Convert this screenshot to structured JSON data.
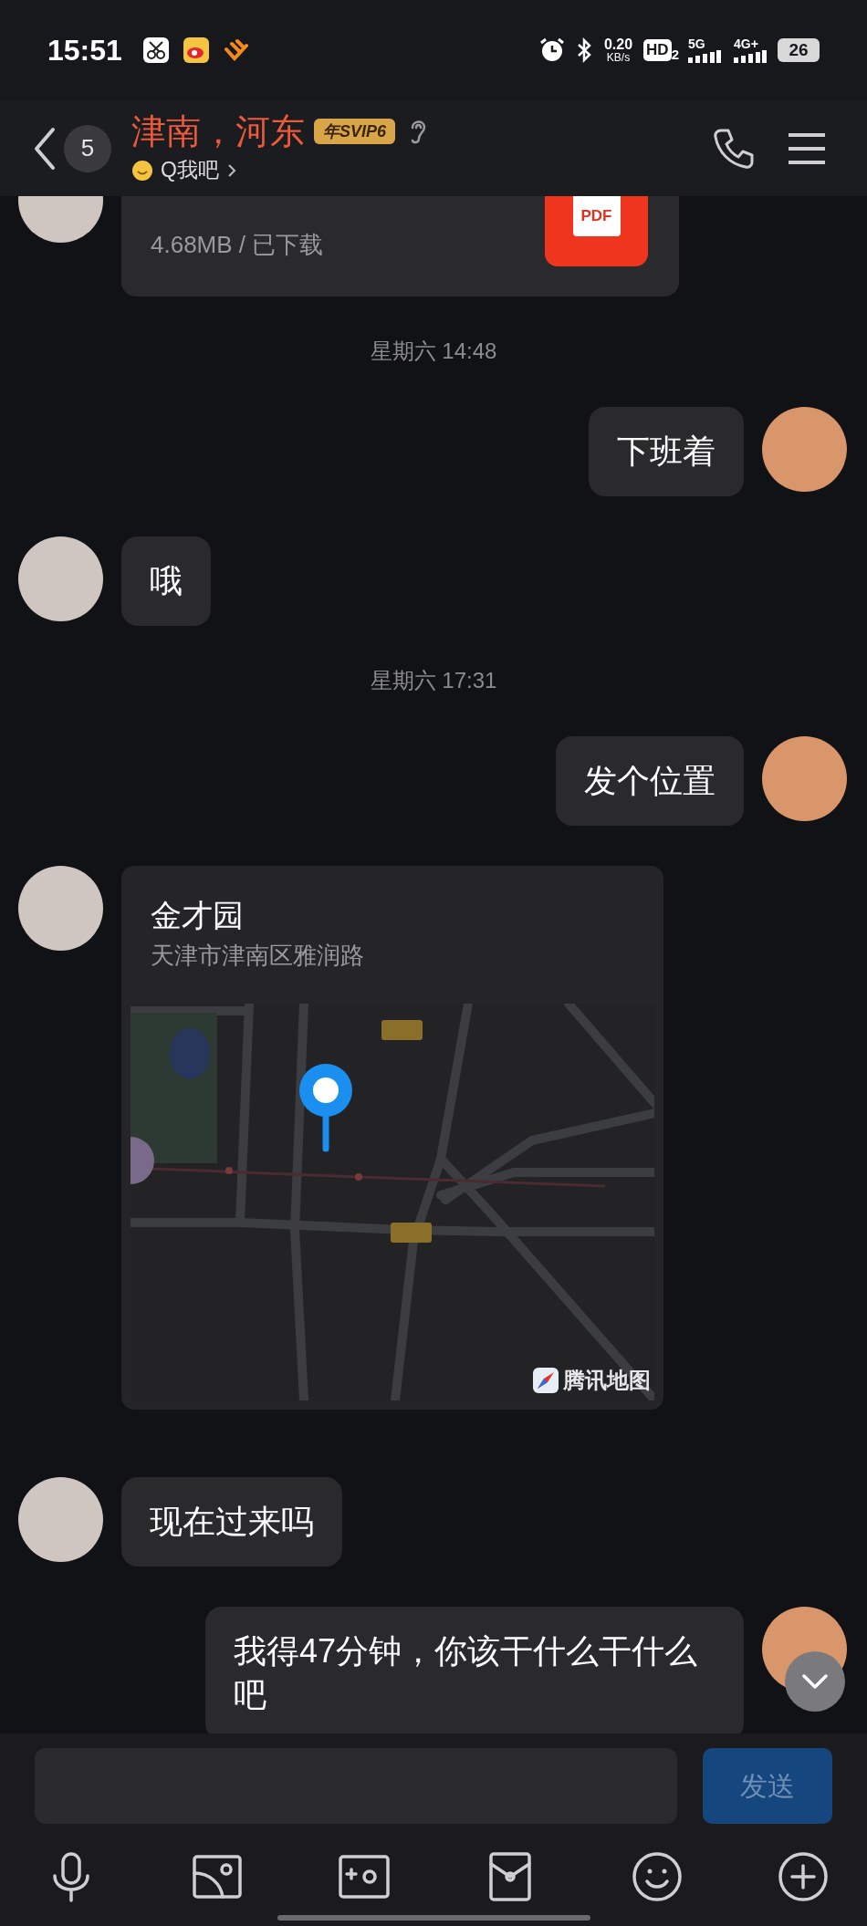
{
  "status_bar": {
    "time": "15:51",
    "net_speed": "0.20",
    "net_unit": "KB/s",
    "hd": "HD",
    "hd_sub": "2",
    "sim1": "5G",
    "sim2": "4G+",
    "battery": "26"
  },
  "header": {
    "unread_count": "5",
    "title": "津南，河东",
    "vip_badge": "年SVIP6",
    "status": "Q我吧"
  },
  "messages": [
    {
      "kind": "file",
      "incoming": true,
      "size": "4.68MB / 已下载",
      "file_type": "PDF"
    },
    {
      "kind": "time",
      "text": "星期六 14:48"
    },
    {
      "kind": "text",
      "incoming": false,
      "text": "下班着"
    },
    {
      "kind": "text",
      "incoming": true,
      "text": "哦"
    },
    {
      "kind": "time",
      "text": "星期六 17:31"
    },
    {
      "kind": "text",
      "incoming": false,
      "text": "发个位置"
    },
    {
      "kind": "location",
      "incoming": true,
      "name": "金才园",
      "address": "天津市津南区雅润路",
      "map_provider": "腾讯地图"
    },
    {
      "kind": "text",
      "incoming": true,
      "text": "现在过来吗"
    },
    {
      "kind": "text",
      "incoming": false,
      "text": "我得47分钟，你该干什么干什么吧"
    }
  ],
  "composer": {
    "send": "发送"
  }
}
